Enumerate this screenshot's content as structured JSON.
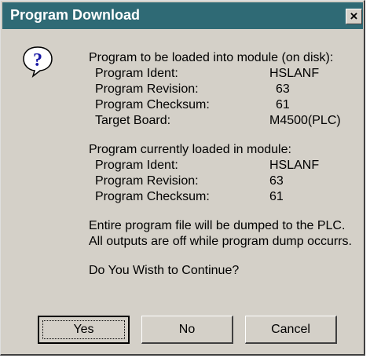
{
  "window": {
    "title": "Program Download",
    "close_glyph": "×"
  },
  "icon": "question-icon",
  "disk_section": {
    "header": "Program to be loaded into module (on disk):",
    "rows": [
      {
        "label": "Program Ident:",
        "value": "HSLANF"
      },
      {
        "label": "Program Revision:",
        "value": "63"
      },
      {
        "label": "Program Checksum:",
        "value": "61"
      },
      {
        "label": "Target Board:",
        "value": "M4500(PLC)"
      }
    ]
  },
  "module_section": {
    "header": "Program currently loaded in module:",
    "rows": [
      {
        "label": "Program Ident:",
        "value": "HSLANF"
      },
      {
        "label": "Program Revision:",
        "value": "63"
      },
      {
        "label": "Program Checksum:",
        "value": "61"
      }
    ]
  },
  "messages": [
    "Entire program file will be dumped to the PLC.",
    "All outputs are off while program dump occurrs."
  ],
  "question": "Do You Wisth to Continue?",
  "buttons": {
    "yes": "Yes",
    "no": "No",
    "cancel": "Cancel"
  }
}
